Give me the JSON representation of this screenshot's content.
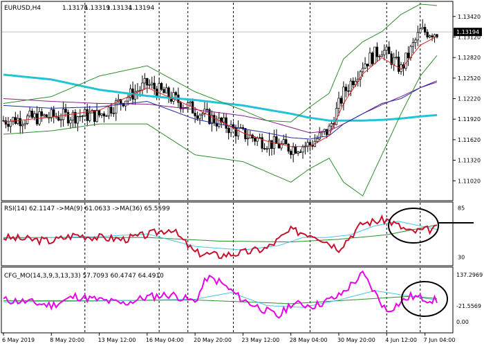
{
  "chart_data": [
    {
      "type": "candlestick",
      "title": "EURUSD,H4",
      "ohlc": {
        "open": "1.13175",
        "high": "1.13319",
        "low": "1.13134",
        "close": "1.13194"
      },
      "current_price": "1.13194",
      "ylim": [
        1.1075,
        1.1362
      ],
      "y_ticks": [
        "1.13420",
        "1.13120",
        "1.12820",
        "1.12520",
        "1.12220",
        "1.11920",
        "1.11620",
        "1.11320",
        "1.11020"
      ],
      "y_tick_values": [
        1.1342,
        1.1312,
        1.1282,
        1.1252,
        1.1222,
        1.1192,
        1.1162,
        1.1132,
        1.1102
      ],
      "anchors_x": [
        0,
        20,
        40,
        60,
        80,
        100,
        110,
        120,
        128,
        136,
        142,
        150,
        158,
        166,
        174,
        181
      ],
      "anchors_close": [
        1.119,
        1.1196,
        1.1198,
        1.1243,
        1.1205,
        1.117,
        1.1158,
        1.115,
        1.1155,
        1.1177,
        1.123,
        1.1272,
        1.1295,
        1.1265,
        1.132,
        1.1319
      ],
      "series": [
        {
          "name": "",
          "kind": "sma",
          "color": "#20c4d6",
          "width": 3,
          "x": [
            0,
            20,
            40,
            60,
            80,
            100,
            110,
            120,
            128,
            136,
            142,
            150,
            158,
            166,
            174,
            181
          ],
          "values": [
            1.1257,
            1.125,
            1.1235,
            1.1226,
            1.122,
            1.1212,
            1.1206,
            1.12,
            1.1194,
            1.119,
            1.119,
            1.119,
            1.1191,
            1.1193,
            1.1196,
            1.1198
          ]
        },
        {
          "name": "",
          "kind": "ma",
          "color": "#8b1a8b",
          "width": 1,
          "x": [
            0,
            20,
            40,
            60,
            80,
            100,
            110,
            120,
            128,
            136,
            142,
            150,
            158,
            166,
            174,
            181
          ],
          "values": [
            1.1222,
            1.1218,
            1.1215,
            1.1214,
            1.1206,
            1.1197,
            1.119,
            1.118,
            1.1172,
            1.1175,
            1.1185,
            1.12,
            1.1213,
            1.1225,
            1.1238,
            1.1246
          ]
        },
        {
          "name": "",
          "kind": "ma",
          "color": "#1e2aa0",
          "width": 1,
          "x": [
            0,
            20,
            40,
            60,
            80,
            100,
            110,
            120,
            128,
            136,
            142,
            150,
            158,
            166,
            174,
            181
          ],
          "values": [
            1.1212,
            1.1208,
            1.121,
            1.1218,
            1.1192,
            1.1178,
            1.1172,
            1.1165,
            1.1163,
            1.1168,
            1.1185,
            1.12,
            1.1215,
            1.1222,
            1.1238,
            1.1248
          ]
        },
        {
          "name": "",
          "kind": "bb_upper",
          "color": "#2e8b2e",
          "width": 1,
          "x": [
            0,
            20,
            40,
            60,
            80,
            100,
            110,
            120,
            128,
            136,
            142,
            150,
            158,
            166,
            174,
            181
          ],
          "values": [
            1.1215,
            1.1225,
            1.1255,
            1.127,
            1.1232,
            1.1205,
            1.119,
            1.1188,
            1.121,
            1.123,
            1.128,
            1.1305,
            1.132,
            1.1345,
            1.136,
            1.1358
          ]
        },
        {
          "name": "",
          "kind": "bb_lower",
          "color": "#2e8b2e",
          "width": 1,
          "x": [
            0,
            20,
            40,
            60,
            80,
            100,
            110,
            120,
            128,
            136,
            142,
            150,
            158,
            166,
            174,
            181
          ],
          "values": [
            1.117,
            1.1175,
            1.1185,
            1.1185,
            1.114,
            1.113,
            1.1115,
            1.11,
            1.112,
            1.1135,
            1.11,
            1.108,
            1.114,
            1.12,
            1.1255,
            1.1285
          ]
        },
        {
          "name": "",
          "kind": "ma_fast",
          "color": "#e02020",
          "width": 1,
          "x": [
            0,
            20,
            40,
            60,
            80,
            100,
            110,
            120,
            128,
            136,
            142,
            150,
            158,
            166,
            174,
            181
          ],
          "values": [
            1.1188,
            1.1195,
            1.1205,
            1.1238,
            1.1208,
            1.1172,
            1.116,
            1.1152,
            1.1152,
            1.1168,
            1.1215,
            1.1258,
            1.1282,
            1.1265,
            1.13,
            1.1313
          ]
        }
      ]
    },
    {
      "type": "line",
      "label": "RSI(14) 62.1147 ->MA(9) 61.0633 ->MA(36) 65.5599",
      "ylim": [
        22,
        90
      ],
      "y_ticks": [
        "85",
        "30"
      ],
      "y_tick_values": [
        85,
        30
      ],
      "series": [
        {
          "name": "RSI(14)",
          "color": "#c8102e",
          "width": 2,
          "x": [
            0,
            10,
            20,
            30,
            40,
            50,
            60,
            70,
            80,
            90,
            100,
            110,
            115,
            120,
            130,
            140,
            150,
            160,
            170,
            181
          ],
          "values": [
            52,
            50,
            48,
            55,
            52,
            50,
            55,
            62,
            35,
            32,
            35,
            40,
            50,
            60,
            55,
            40,
            68,
            72,
            58,
            62
          ]
        },
        {
          "name": "MA(9)",
          "color": "#40c8e0",
          "width": 1,
          "x": [
            0,
            20,
            40,
            60,
            80,
            100,
            115,
            125,
            135,
            145,
            155,
            165,
            181
          ],
          "values": [
            51,
            52,
            53,
            56,
            42,
            38,
            43,
            52,
            52,
            55,
            65,
            70,
            61
          ]
        },
        {
          "name": "MA(36)",
          "color": "#2e8b2e",
          "width": 1,
          "x": [
            0,
            30,
            60,
            90,
            120,
            140,
            160,
            181
          ],
          "values": [
            52,
            52,
            52,
            48,
            47,
            50,
            55,
            66
          ]
        }
      ]
    },
    {
      "type": "line",
      "label": "CFG_MO(14,3,9,3,13,33) 57.7093 60.4747 64.4910",
      "ylim": [
        -25,
        145
      ],
      "y_ticks": [
        "137.2969",
        "-21.5569",
        "0.00"
      ],
      "y_tick_values": [
        137.2969,
        -21.5569,
        0
      ],
      "series": [
        {
          "name": "CFG_MO",
          "color": "#e800e8",
          "width": 2,
          "x": [
            0,
            10,
            20,
            30,
            40,
            50,
            60,
            70,
            80,
            85,
            90,
            100,
            110,
            115,
            120,
            130,
            140,
            150,
            160,
            170,
            181
          ],
          "values": [
            60,
            55,
            45,
            70,
            60,
            50,
            68,
            75,
            55,
            120,
            110,
            60,
            30,
            15,
            50,
            45,
            70,
            130,
            30,
            70,
            58
          ]
        },
        {
          "name": "",
          "color": "#40c8e0",
          "width": 1,
          "x": [
            0,
            20,
            40,
            60,
            80,
            95,
            110,
            125,
            140,
            155,
            165,
            181
          ],
          "values": [
            55,
            56,
            57,
            60,
            62,
            80,
            45,
            40,
            60,
            85,
            75,
            60
          ]
        },
        {
          "name": "",
          "color": "#2e8b2e",
          "width": 1,
          "x": [
            0,
            40,
            80,
            120,
            150,
            170,
            181
          ],
          "values": [
            58,
            58,
            60,
            50,
            62,
            70,
            64
          ]
        }
      ]
    }
  ],
  "x_axis": {
    "labels": [
      "6 May 2019",
      "8 May 20:00",
      "13 May 12:00",
      "16 May 04:00",
      "20 May 20:00",
      "23 May 12:00",
      "28 May 04:00",
      "30 May 20:00",
      "4 Jun 12:00",
      "7 Jun 04:00"
    ],
    "label_positions": [
      0,
      20,
      40,
      60,
      80,
      100,
      120,
      140,
      160,
      176
    ],
    "period_separators": [
      34,
      65,
      77,
      96,
      128,
      160,
      174
    ],
    "total_bars": 182
  },
  "annotations": [
    "ellipse",
    "arrow-line",
    "ellipse"
  ]
}
